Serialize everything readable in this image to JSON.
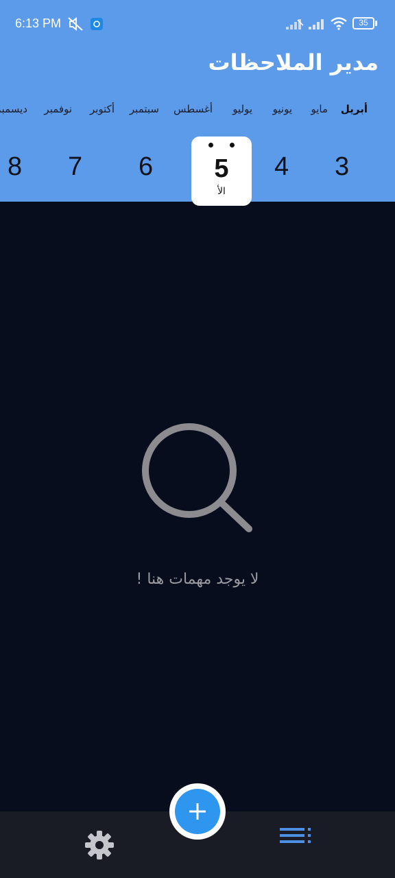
{
  "status_bar": {
    "time": "6:13 PM",
    "battery": "35"
  },
  "app": {
    "title": "مدير الملاحظات"
  },
  "months": [
    {
      "label": "أبريل",
      "active": true
    },
    {
      "label": "مايو",
      "active": false
    },
    {
      "label": "يونيو",
      "active": false
    },
    {
      "label": "يوليو",
      "active": false
    },
    {
      "label": "أغسطس",
      "active": false
    },
    {
      "label": "سبتمبر",
      "active": false
    },
    {
      "label": "أكتوبر",
      "active": false
    },
    {
      "label": "نوفمبر",
      "active": false
    },
    {
      "label": "ديسمبر",
      "active": false
    }
  ],
  "days": [
    {
      "number": "3"
    },
    {
      "number": "4"
    },
    {
      "number": "6"
    },
    {
      "number": "7"
    },
    {
      "number": "8"
    }
  ],
  "selected_day": {
    "number": "5",
    "weekday": "الأ"
  },
  "empty_state": {
    "message": "لا يوجد مهمات هنا !",
    "icon": "search-icon"
  },
  "bottom_nav": {
    "add_icon": "plus-icon",
    "settings_icon": "gear-icon",
    "list_icon": "list-icon"
  },
  "colors": {
    "header": "#5b9bea",
    "background": "#070d1c",
    "fab": "#2f96ef",
    "bottom_bar": "#191c24"
  }
}
